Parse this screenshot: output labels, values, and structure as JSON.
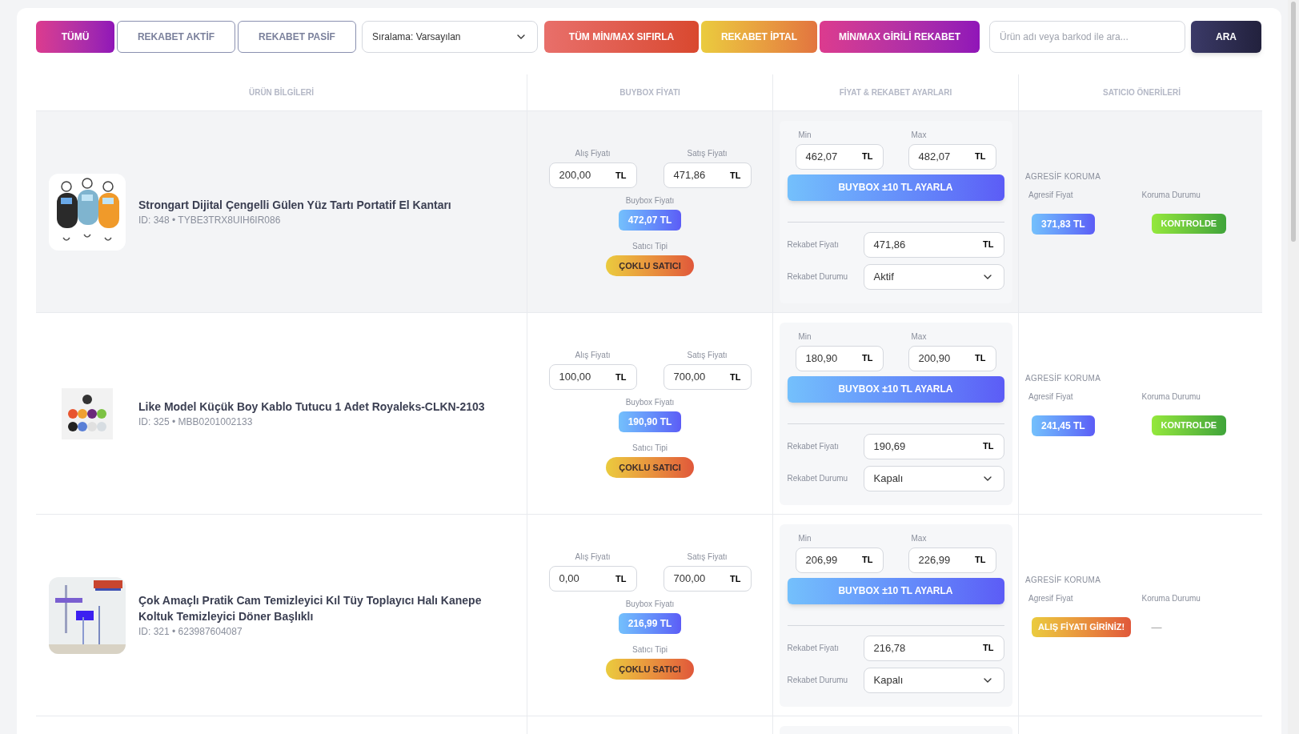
{
  "filters": [
    {
      "label": "TÜMÜ",
      "selected": true
    },
    {
      "label": "REKABET AKTİF",
      "selected": false
    },
    {
      "label": "REKABET PASİF",
      "selected": false
    }
  ],
  "sort_select": {
    "value": "Sıralama: Varsayılan"
  },
  "actions": [
    {
      "kind": "reset",
      "label": "TÜM MİN/MAX SIFIRLA"
    },
    {
      "kind": "cancel",
      "label": "REKABET İPTAL"
    },
    {
      "kind": "minmax",
      "label": "MİN/MAX GİRİLİ REKABET"
    }
  ],
  "search": {
    "placeholder": "Ürün adı veya barkod ile ara...",
    "button": "ARA"
  },
  "table": {
    "columns": [
      "ÜRÜN BİLGİLERİ",
      "BUYBOX FİYATI",
      "FİYAT & REKABET AYARLARI",
      "SATICIO ÖNERİLERİ"
    ],
    "rows": [
      {
        "highlighted": true,
        "product": {
          "title": "Strongart Dijital Çengelli Gülen Yüz Tartı Portatif El Kantarı",
          "meta": "ID: 348 • TYBE3TRX8UIH6IR086"
        },
        "buybox": {
          "purchase": {
            "label": "Alış Fiyatı",
            "value": "200,00",
            "unit": "TL"
          },
          "sale": {
            "label": "Satış Fiyatı",
            "value": "471,86",
            "unit": "TL"
          },
          "buybox_label": "Buybox Fiyatı",
          "buybox_price": "472,07 TL",
          "seller_label": "Satıcı Tipi",
          "seller_type": "ÇOKLU SATICI"
        },
        "settings": {
          "min": {
            "label": "Min",
            "value": "462,07",
            "unit": "TL"
          },
          "max": {
            "label": "Max",
            "value": "482,07",
            "unit": "TL"
          },
          "adjust_button": "BUYBOX ±10 TL AYARLA",
          "rival_price": {
            "label": "Rekabet Fiyatı",
            "value": "471,86",
            "unit": "TL"
          },
          "rival_status": {
            "label": "Rekabet Durumu",
            "value": "Aktif"
          }
        },
        "suggestions": {
          "heading": "AGRESİF KORUMA",
          "price_label": "Agresif Fiyat",
          "status_label": "Koruma Durumu",
          "price": {
            "kind": "price",
            "text": "371,83 TL"
          },
          "status": {
            "kind": "badge",
            "text": "KONTROLDE"
          }
        }
      },
      {
        "highlighted": false,
        "product": {
          "title": "Like Model Küçük Boy Kablo Tutucu 1 Adet Royaleks-CLKN-2103",
          "meta": "ID: 325 • MBB0201002133"
        },
        "buybox": {
          "purchase": {
            "label": "Alış Fiyatı",
            "value": "100,00",
            "unit": "TL"
          },
          "sale": {
            "label": "Satış Fiyatı",
            "value": "700,00",
            "unit": "TL"
          },
          "buybox_label": "Buybox Fiyatı",
          "buybox_price": "190,90 TL",
          "seller_label": "Satıcı Tipi",
          "seller_type": "ÇOKLU SATICI"
        },
        "settings": {
          "min": {
            "label": "Min",
            "value": "180,90",
            "unit": "TL"
          },
          "max": {
            "label": "Max",
            "value": "200,90",
            "unit": "TL"
          },
          "adjust_button": "BUYBOX ±10 TL AYARLA",
          "rival_price": {
            "label": "Rekabet Fiyatı",
            "value": "190,69",
            "unit": "TL"
          },
          "rival_status": {
            "label": "Rekabet Durumu",
            "value": "Kapalı"
          }
        },
        "suggestions": {
          "heading": "AGRESİF KORUMA",
          "price_label": "Agresif Fiyat",
          "status_label": "Koruma Durumu",
          "price": {
            "kind": "price",
            "text": "241,45 TL"
          },
          "status": {
            "kind": "badge",
            "text": "KONTROLDE"
          }
        }
      },
      {
        "highlighted": false,
        "product": {
          "title": "Çok Amaçlı Pratik Cam Temizleyici Kıl Tüy Toplayıcı Halı Kanepe Koltuk Temizleyici Döner Başlıklı",
          "meta": "ID: 321 • 623987604087"
        },
        "buybox": {
          "purchase": {
            "label": "Alış Fiyatı",
            "value": "0,00",
            "unit": "TL"
          },
          "sale": {
            "label": "Satış Fiyatı",
            "value": "700,00",
            "unit": "TL"
          },
          "buybox_label": "Buybox Fiyatı",
          "buybox_price": "216,99 TL",
          "seller_label": "Satıcı Tipi",
          "seller_type": "ÇOKLU SATICI"
        },
        "settings": {
          "min": {
            "label": "Min",
            "value": "206,99",
            "unit": "TL"
          },
          "max": {
            "label": "Max",
            "value": "226,99",
            "unit": "TL"
          },
          "adjust_button": "BUYBOX ±10 TL AYARLA",
          "rival_price": {
            "label": "Rekabet Fiyatı",
            "value": "216,78",
            "unit": "TL"
          },
          "rival_status": {
            "label": "Rekabet Durumu",
            "value": "Kapalı"
          }
        },
        "suggestions": {
          "heading": "AGRESİF KORUMA",
          "price_label": "Agresif Fiyat",
          "status_label": "Koruma Durumu",
          "price": {
            "kind": "warning",
            "text": "ALIŞ FİYATI GİRİNİZ!"
          },
          "status": {
            "kind": "dash",
            "text": "—"
          }
        }
      }
    ]
  }
}
